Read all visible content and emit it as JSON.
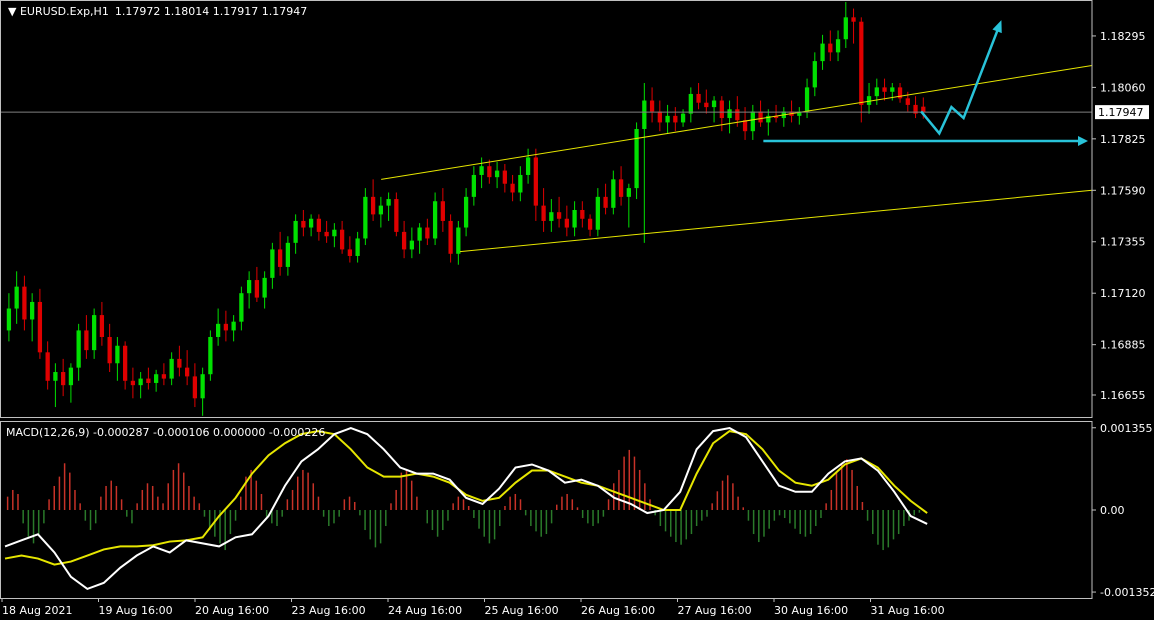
{
  "chart_data": [
    {
      "type": "candlestick",
      "title": "EURUSD.Exp,H1",
      "ohlc_text": "1.17972 1.18014 1.17917 1.17947",
      "y_ticks": [
        "1.18295",
        "1.18060",
        "1.17825",
        "1.17590",
        "1.17355",
        "1.17120",
        "1.16885",
        "1.16655"
      ],
      "ylim": [
        1.1655,
        1.1845
      ],
      "current_price": "1.17947",
      "current_price_value": 1.17947,
      "up_color": "#00e000",
      "down_color": "#e00000",
      "channel_color": "#e6e600",
      "annotation_color": "#29c3d9",
      "channel_lines": [
        {
          "from": [
            62,
            1.1764
          ],
          "to": [
            180,
            1.1816
          ]
        },
        {
          "from": [
            75,
            1.1731
          ],
          "to": [
            180,
            1.1759
          ]
        }
      ],
      "support_line": {
        "from": [
          125,
          1.17815
        ],
        "to": [
          180,
          1.17815
        ]
      },
      "forecast_path": [
        [
          151,
          1.1795
        ],
        [
          154,
          1.1785
        ],
        [
          156,
          1.1797
        ],
        [
          158,
          1.1792
        ],
        [
          164,
          1.1835
        ]
      ],
      "forecast_arrow": [
        [
          158,
          1.1792
        ],
        [
          164,
          1.1835
        ]
      ],
      "candles": [
        [
          1.1695,
          1.1712,
          1.169,
          1.1705
        ],
        [
          1.1705,
          1.1722,
          1.1698,
          1.1715
        ],
        [
          1.1715,
          1.172,
          1.1695,
          1.17
        ],
        [
          1.17,
          1.1712,
          1.169,
          1.1708
        ],
        [
          1.1708,
          1.1714,
          1.1682,
          1.1685
        ],
        [
          1.1685,
          1.169,
          1.1668,
          1.1672
        ],
        [
          1.1672,
          1.168,
          1.166,
          1.1676
        ],
        [
          1.1676,
          1.1682,
          1.1665,
          1.167
        ],
        [
          1.167,
          1.168,
          1.1662,
          1.1678
        ],
        [
          1.1678,
          1.1698,
          1.1672,
          1.1695
        ],
        [
          1.1695,
          1.1702,
          1.1682,
          1.1686
        ],
        [
          1.1686,
          1.1705,
          1.1682,
          1.1702
        ],
        [
          1.1702,
          1.1708,
          1.1688,
          1.1692
        ],
        [
          1.1692,
          1.1698,
          1.1676,
          1.168
        ],
        [
          1.168,
          1.1692,
          1.1672,
          1.1688
        ],
        [
          1.1688,
          1.169,
          1.1668,
          1.1672
        ],
        [
          1.1672,
          1.1678,
          1.1664,
          1.167
        ],
        [
          1.167,
          1.1676,
          1.1664,
          1.1673
        ],
        [
          1.1673,
          1.1678,
          1.1668,
          1.1671
        ],
        [
          1.1671,
          1.1677,
          1.1667,
          1.1675
        ],
        [
          1.1675,
          1.168,
          1.167,
          1.1673
        ],
        [
          1.1673,
          1.1685,
          1.167,
          1.1682
        ],
        [
          1.1682,
          1.1688,
          1.1674,
          1.1678
        ],
        [
          1.1678,
          1.1686,
          1.167,
          1.1674
        ],
        [
          1.1674,
          1.168,
          1.166,
          1.1664
        ],
        [
          1.1664,
          1.1678,
          1.1656,
          1.1675
        ],
        [
          1.1675,
          1.1695,
          1.1672,
          1.1692
        ],
        [
          1.1692,
          1.1705,
          1.1688,
          1.1698
        ],
        [
          1.1698,
          1.1704,
          1.169,
          1.1695
        ],
        [
          1.1695,
          1.1702,
          1.169,
          1.1699
        ],
        [
          1.1699,
          1.1715,
          1.1695,
          1.1712
        ],
        [
          1.1712,
          1.1722,
          1.1705,
          1.1718
        ],
        [
          1.1718,
          1.1724,
          1.1708,
          1.171
        ],
        [
          1.171,
          1.1722,
          1.1705,
          1.1719
        ],
        [
          1.1719,
          1.1735,
          1.1714,
          1.1732
        ],
        [
          1.1732,
          1.174,
          1.172,
          1.1724
        ],
        [
          1.1724,
          1.1738,
          1.172,
          1.1735
        ],
        [
          1.1735,
          1.1748,
          1.173,
          1.1745
        ],
        [
          1.1745,
          1.175,
          1.1738,
          1.1742
        ],
        [
          1.1742,
          1.1748,
          1.1738,
          1.1746
        ],
        [
          1.1746,
          1.1748,
          1.1736,
          1.174
        ],
        [
          1.174,
          1.1745,
          1.1735,
          1.1738
        ],
        [
          1.1738,
          1.1744,
          1.1733,
          1.1741
        ],
        [
          1.1741,
          1.1745,
          1.173,
          1.1732
        ],
        [
          1.1732,
          1.1738,
          1.1726,
          1.1729
        ],
        [
          1.1729,
          1.174,
          1.1726,
          1.1737
        ],
        [
          1.1737,
          1.176,
          1.1734,
          1.1756
        ],
        [
          1.1756,
          1.1764,
          1.1745,
          1.1748
        ],
        [
          1.1748,
          1.1756,
          1.1742,
          1.1752
        ],
        [
          1.1752,
          1.1758,
          1.1745,
          1.1755
        ],
        [
          1.1755,
          1.1758,
          1.1738,
          1.174
        ],
        [
          1.174,
          1.1745,
          1.1728,
          1.1732
        ],
        [
          1.1732,
          1.1742,
          1.1728,
          1.1736
        ],
        [
          1.1736,
          1.1744,
          1.173,
          1.1742
        ],
        [
          1.1742,
          1.1746,
          1.1734,
          1.1737
        ],
        [
          1.1737,
          1.1758,
          1.1734,
          1.1754
        ],
        [
          1.1754,
          1.176,
          1.174,
          1.1745
        ],
        [
          1.1745,
          1.1748,
          1.1726,
          1.173
        ],
        [
          1.173,
          1.1745,
          1.1725,
          1.1742
        ],
        [
          1.1742,
          1.176,
          1.1738,
          1.1756
        ],
        [
          1.1756,
          1.177,
          1.1752,
          1.1766
        ],
        [
          1.1766,
          1.1774,
          1.176,
          1.177
        ],
        [
          1.177,
          1.1773,
          1.1762,
          1.1765
        ],
        [
          1.1765,
          1.1772,
          1.176,
          1.1768
        ],
        [
          1.1768,
          1.1771,
          1.1758,
          1.1762
        ],
        [
          1.1762,
          1.1766,
          1.1754,
          1.1758
        ],
        [
          1.1758,
          1.177,
          1.1754,
          1.1766
        ],
        [
          1.1766,
          1.1778,
          1.1762,
          1.1774
        ],
        [
          1.1774,
          1.1778,
          1.1745,
          1.1752
        ],
        [
          1.1752,
          1.176,
          1.174,
          1.1745
        ],
        [
          1.1745,
          1.1755,
          1.174,
          1.1749
        ],
        [
          1.1749,
          1.1756,
          1.1742,
          1.1746
        ],
        [
          1.1746,
          1.1752,
          1.1738,
          1.1742
        ],
        [
          1.1742,
          1.1754,
          1.1738,
          1.175
        ],
        [
          1.175,
          1.1754,
          1.1742,
          1.1746
        ],
        [
          1.1746,
          1.1748,
          1.1738,
          1.1741
        ],
        [
          1.1741,
          1.176,
          1.1738,
          1.1756
        ],
        [
          1.1756,
          1.1762,
          1.1748,
          1.1751
        ],
        [
          1.1751,
          1.1768,
          1.1748,
          1.1764
        ],
        [
          1.1764,
          1.177,
          1.1752,
          1.1756
        ],
        [
          1.1756,
          1.1762,
          1.1742,
          1.176
        ],
        [
          1.176,
          1.179,
          1.1755,
          1.1787
        ],
        [
          1.1787,
          1.1808,
          1.1735,
          1.18
        ],
        [
          1.18,
          1.1806,
          1.179,
          1.1795
        ],
        [
          1.1795,
          1.18,
          1.1786,
          1.179
        ],
        [
          1.179,
          1.1798,
          1.1785,
          1.1793
        ],
        [
          1.1793,
          1.1797,
          1.1786,
          1.179
        ],
        [
          1.179,
          1.1796,
          1.1788,
          1.1794
        ],
        [
          1.1794,
          1.1806,
          1.179,
          1.1803
        ],
        [
          1.1803,
          1.1808,
          1.1796,
          1.1799
        ],
        [
          1.1799,
          1.1805,
          1.1794,
          1.1797
        ],
        [
          1.1797,
          1.1802,
          1.179,
          1.18
        ],
        [
          1.18,
          1.1802,
          1.1786,
          1.1792
        ],
        [
          1.1792,
          1.18,
          1.1785,
          1.1796
        ],
        [
          1.1796,
          1.1802,
          1.1788,
          1.1791
        ],
        [
          1.1791,
          1.1797,
          1.1782,
          1.1786
        ],
        [
          1.1786,
          1.1798,
          1.1782,
          1.1795
        ],
        [
          1.1795,
          1.18,
          1.1788,
          1.179
        ],
        [
          1.179,
          1.1796,
          1.1784,
          1.1793
        ],
        [
          1.1793,
          1.1798,
          1.179,
          1.1792
        ],
        [
          1.1792,
          1.1797,
          1.1788,
          1.1795
        ],
        [
          1.1795,
          1.18,
          1.179,
          1.1793
        ],
        [
          1.1793,
          1.1797,
          1.1789,
          1.1795
        ],
        [
          1.1795,
          1.181,
          1.1792,
          1.1806
        ],
        [
          1.1806,
          1.1822,
          1.1802,
          1.1818
        ],
        [
          1.1818,
          1.183,
          1.1814,
          1.1826
        ],
        [
          1.1826,
          1.1832,
          1.1818,
          1.1822
        ],
        [
          1.1822,
          1.1832,
          1.1818,
          1.1828
        ],
        [
          1.1828,
          1.1845,
          1.1824,
          1.1838
        ],
        [
          1.1838,
          1.1842,
          1.1826,
          1.1836
        ],
        [
          1.1836,
          1.1838,
          1.179,
          1.1798
        ],
        [
          1.1798,
          1.1808,
          1.1794,
          1.1802
        ],
        [
          1.1802,
          1.181,
          1.1798,
          1.1806
        ],
        [
          1.1806,
          1.181,
          1.18,
          1.1804
        ],
        [
          1.1804,
          1.1808,
          1.18,
          1.1806
        ],
        [
          1.1806,
          1.1808,
          1.1799,
          1.1801
        ],
        [
          1.1801,
          1.1804,
          1.1795,
          1.1798
        ],
        [
          1.1798,
          1.1802,
          1.1792,
          1.1794
        ],
        [
          1.17972,
          1.18014,
          1.17917,
          1.17947
        ]
      ],
      "bar_start": 0,
      "x_bars": 180
    },
    {
      "type": "macd",
      "label": "MACD(12,26,9) -0.000287 -0.000106 0.000000 -0.000226",
      "y_ticks": [
        "0.001355",
        "0.00",
        "-0.001352"
      ],
      "ylim": [
        -0.00145,
        0.00145
      ],
      "main_color": "#ffffff",
      "signal_color": "#e6e600",
      "hist_up_color": "#c83228",
      "hist_down_color": "#2a7a2a",
      "main_line": [
        -0.0006,
        -0.0005,
        -0.0004,
        -0.0007,
        -0.0011,
        -0.0013,
        -0.0012,
        -0.00095,
        -0.00075,
        -0.0006,
        -0.0007,
        -0.0005,
        -0.00055,
        -0.0006,
        -0.00045,
        -0.0004,
        -0.0001,
        0.0004,
        0.0008,
        0.001,
        0.00125,
        0.00135,
        0.00125,
        0.001,
        0.0007,
        0.0006,
        0.0006,
        0.0005,
        0.0002,
        0.0001,
        0.00035,
        0.0007,
        0.00075,
        0.00065,
        0.00045,
        0.0005,
        0.0004,
        0.0002,
        0.0001,
        -5e-05,
        0.0,
        0.0003,
        0.001,
        0.0013,
        0.00135,
        0.0012,
        0.0008,
        0.0004,
        0.0003,
        0.0003,
        0.0006,
        0.0008,
        0.00085,
        0.00065,
        0.0003,
        -0.0001,
        -0.00023
      ],
      "signal_line": [
        -0.0008,
        -0.00075,
        -0.0008,
        -0.0009,
        -0.00085,
        -0.00075,
        -0.00065,
        -0.0006,
        -0.0006,
        -0.00058,
        -0.00052,
        -0.0005,
        -0.00045,
        -0.0001,
        0.0002,
        0.0006,
        0.0009,
        0.0011,
        0.00125,
        0.0013,
        0.00125,
        0.001,
        0.0007,
        0.00055,
        0.00055,
        0.0006,
        0.00055,
        0.00045,
        0.00025,
        0.00015,
        0.0002,
        0.00045,
        0.00065,
        0.00065,
        0.00055,
        0.00045,
        0.0004,
        0.0003,
        0.0002,
        0.0001,
        0.0,
        0.0,
        0.0006,
        0.0011,
        0.0013,
        0.00125,
        0.001,
        0.00065,
        0.00045,
        0.0004,
        0.0005,
        0.00075,
        0.00085,
        0.0007,
        0.0004,
        0.00015,
        -5e-05
      ],
      "histogram": [
        0.0001,
        0.00015,
        0.00012,
        -0.0001,
        -0.0002,
        -0.00025,
        -0.00018,
        -0.0001,
        8e-05,
        0.00018,
        0.00025,
        0.00035,
        0.00028,
        0.00015,
        5e-05,
        -8e-05,
        -0.00015,
        -0.0001,
        0.0001,
        0.00018,
        0.00022,
        0.00018,
        8e-05,
        -5e-05,
        -0.0001,
        5e-05,
        0.00015,
        0.0002,
        0.00018,
        0.0001,
        5e-05,
        0.0002,
        0.0003,
        0.00035,
        0.00028,
        0.00018,
        0.0001,
        5e-05,
        -5e-05,
        -0.00015,
        -0.0002,
        -0.00025,
        -0.0003,
        -0.00018,
        -8e-05,
        0.0001,
        0.00025,
        0.0003,
        0.00022,
        0.00012,
        -5e-05,
        -0.0001,
        -0.00012,
        -5e-05,
        8e-05,
        0.00015,
        0.00025,
        0.0003,
        0.00028,
        0.0002,
        0.0001,
        -5e-05,
        -0.00012,
        -0.0001,
        -5e-05,
        8e-05,
        0.0001,
        6e-05,
        -4e-05,
        -0.00015,
        -0.00022,
        -0.00028,
        -0.00025,
        -0.00012,
        5e-05,
        0.00015,
        0.00028,
        0.0003,
        0.00022,
        0.0001,
        0.0,
        -0.0001,
        -0.00015,
        -0.0002,
        -0.00015,
        -8e-05,
        5e-05,
        0.0001,
        8e-05,
        3e-05,
        -6e-05,
        -0.00014,
        -0.0002,
        -0.00025,
        -0.00022,
        -0.00012,
        3e-05,
        0.0001,
        0.00012,
        8e-05,
        -4e-05,
        -0.00012,
        -0.00016,
        -0.0002,
        -0.00018,
        -0.0001,
        4e-05,
        0.0001,
        0.00012,
        8e-05,
        2e-05,
        -6e-05,
        -0.0001,
        -0.00012,
        -0.0001,
        -5e-05,
        8e-05,
        0.0002,
        0.0003,
        0.0004,
        0.00045,
        0.0004,
        0.0003,
        0.0002,
        8e-05,
        -4e-05,
        -0.00012,
        -0.00016,
        -0.0002,
        -0.00024,
        -0.00026,
        -0.00022,
        -0.00018,
        -0.00012,
        -8e-05,
        -5e-05,
        5e-05,
        0.00014,
        0.00022,
        0.00026,
        0.0002,
        0.0001,
        2e-05,
        -8e-05,
        -0.00018,
        -0.00024,
        -0.0002,
        -0.00014,
        -8e-05,
        -4e-05,
        -6e-05,
        -0.0001,
        -0.00014,
        -0.00018,
        -0.0002,
        -0.00018,
        -0.00012,
        -6e-05,
        5e-05,
        0.00015,
        0.00028,
        0.00035,
        0.00038,
        0.0003,
        0.00018,
        6e-05,
        -8e-05,
        -0.00018,
        -0.00026,
        -0.0003,
        -0.00028,
        -0.00022,
        -0.00018,
        -0.00012,
        -8e-05,
        -4e-05,
        -2e-05,
        0.0
      ]
    }
  ],
  "x_axis": {
    "ticks": [
      "18 Aug 2021",
      "19 Aug 16:00",
      "20 Aug 16:00",
      "23 Aug 16:00",
      "24 Aug 16:00",
      "25 Aug 16:00",
      "26 Aug 16:00",
      "27 Aug 16:00",
      "30 Aug 16:00",
      "31 Aug 16:00"
    ]
  }
}
